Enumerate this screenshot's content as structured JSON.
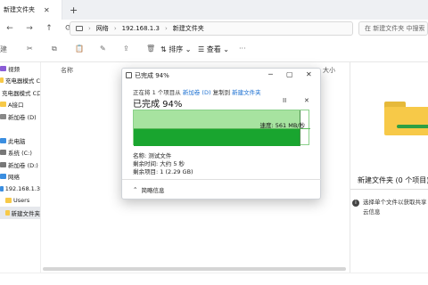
{
  "tab": {
    "title": "新建文件夹",
    "close": "✕",
    "plus": "+"
  },
  "nav": {
    "back": "←",
    "forward": "→",
    "up": "↑",
    "refresh": "⟳"
  },
  "address": {
    "segments": [
      "网络",
      "192.168.1.3",
      "新建文件夹"
    ],
    "sep": "›"
  },
  "search": {
    "placeholder": "在 新建文件夹 中搜索"
  },
  "toolbar": {
    "new_label": "建",
    "sort_label": "排序",
    "view_label": "查看",
    "more_label": "···"
  },
  "columns": {
    "name": "名称",
    "size": "大小"
  },
  "sidebar": {
    "items": [
      {
        "label": "视频",
        "icon": "video-icon"
      },
      {
        "label": "充电器模式 C",
        "icon": "folder-icon"
      },
      {
        "label": "充电器模式 C口",
        "icon": "folder-icon"
      },
      {
        "label": "A接口",
        "icon": "folder-icon"
      },
      {
        "label": "新加卷 (D)",
        "icon": "drive-icon"
      },
      {
        "label": "",
        "icon": ""
      },
      {
        "label": "此电脑",
        "icon": "pc-icon"
      },
      {
        "label": "系统 (C:)",
        "icon": "drive-icon"
      },
      {
        "label": "新加卷 (D:)",
        "icon": "drive-icon"
      },
      {
        "label": "网络",
        "icon": "network-icon"
      },
      {
        "label": "192.168.1.3",
        "icon": "computer-icon"
      },
      {
        "label": "Users",
        "icon": "folder-icon"
      },
      {
        "label": "新建文件夹",
        "icon": "folder-icon"
      }
    ]
  },
  "dialog": {
    "title": "已完成 94%",
    "minimize": "─",
    "maximize": "▢",
    "close": "✕",
    "desc_prefix": "正在将 1 个项目从 ",
    "desc_src": "新加卷 (D)",
    "desc_mid": " 复制到 ",
    "desc_dst": "新建文件夹",
    "big_progress": "已完成 94%",
    "pause": "II",
    "cancel": "✕",
    "progress": 0.94,
    "speed": "速度: 561 MB/秒",
    "name_row": "名称: 测试文件",
    "time_row": "剩余时间: 大约 5 秒",
    "items_row": "剩余项目: 1 (2.29 GB)",
    "less": "简略信息",
    "less_icon": "⌃"
  },
  "preview": {
    "title": "新建文件夹 (0 个项目)",
    "info": "选择单个文件以获取共享云信息",
    "info_icon": "i"
  },
  "colors": {
    "folder": "#f7c948",
    "progress_light": "#a7e3a0",
    "progress_dark": "#19a52f",
    "link": "#1a6fd1"
  }
}
